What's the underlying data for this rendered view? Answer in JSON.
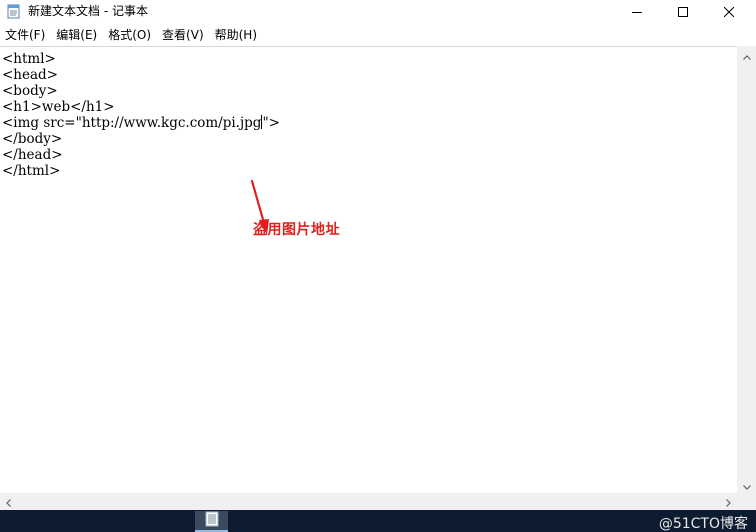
{
  "window": {
    "title": "新建文本文档 - 记事本"
  },
  "menu": [
    {
      "label": "文件(F)"
    },
    {
      "label": "编辑(E)"
    },
    {
      "label": "格式(O)"
    },
    {
      "label": "查看(V)"
    },
    {
      "label": "帮助(H)"
    }
  ],
  "editor": {
    "lines": [
      "<html>",
      "<head>",
      "<body>",
      "<h1>web</h1>",
      "<img src=\"http://www.kgc.com/pi.jpg\">",
      "</body>",
      "</head>",
      "</html>"
    ],
    "caret_line": 4,
    "caret_after": "<img src=\"http://www.kgc.com/pi.jpg"
  },
  "annotation": {
    "text": "盗用图片地址",
    "color": "#e02020"
  },
  "watermark": {
    "text": "@51CTO博客"
  },
  "colors": {
    "taskbar": "#0d1c30",
    "accent": "#8fb8e8"
  },
  "icons": {
    "app": "notepad-icon",
    "minimize": "minimize-icon",
    "maximize": "maximize-icon",
    "close": "close-icon"
  }
}
